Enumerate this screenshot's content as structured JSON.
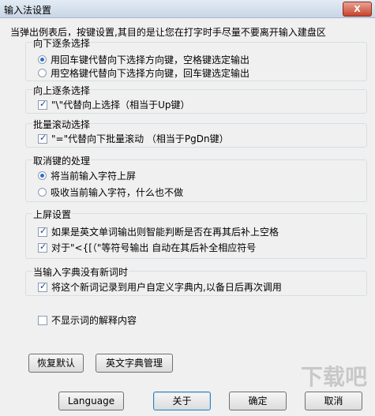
{
  "window": {
    "title": "输入法设置",
    "close_label": "X"
  },
  "hint": "当弹出例表后，按键设置,其目的是让您在打字时手尽量不要离开输入建盘区",
  "groups": {
    "down": {
      "title": "向下逐条选择",
      "option1": "用回车键代替向下选择方向键，空格键选定输出",
      "option2": "用空格键代替向下选择方向键，回车键选定输出",
      "selected": 0
    },
    "up": {
      "title": "向上逐条选择",
      "check_label": "\"\\\"代替向上选择（相当于Up键）",
      "checked": true
    },
    "batch": {
      "title": "批量滚动选择",
      "check_label": "\"=\"代替向下批量滚动 （相当于PgDn键）",
      "checked": true
    },
    "cancel": {
      "title": "取消键的处理",
      "option1": "将当前输入字符上屏",
      "option2": "吸收当前输入字符，什么也不做",
      "selected": 0
    },
    "screen": {
      "title": "上屏设置",
      "check1": "如果是英文单词输出则智能判断是否在再其后补上空格",
      "check2": "对于\"<{[（\"等符号输出 自动在其后补全相应符号",
      "checked1": true,
      "checked2": true
    },
    "nodict": {
      "title": "当输入字典没有新词时",
      "check_label": "将这个新词记录到用户自定义字典内,以备日后再次调用",
      "checked": true
    }
  },
  "no_explain_label": "不显示词的解释内容",
  "buttons": {
    "restore": "恢复默认",
    "dict_manage": "英文字典管理",
    "language": "Language",
    "about": "关于",
    "ok": "确定",
    "cancel": "取消"
  },
  "watermark": "下载吧"
}
